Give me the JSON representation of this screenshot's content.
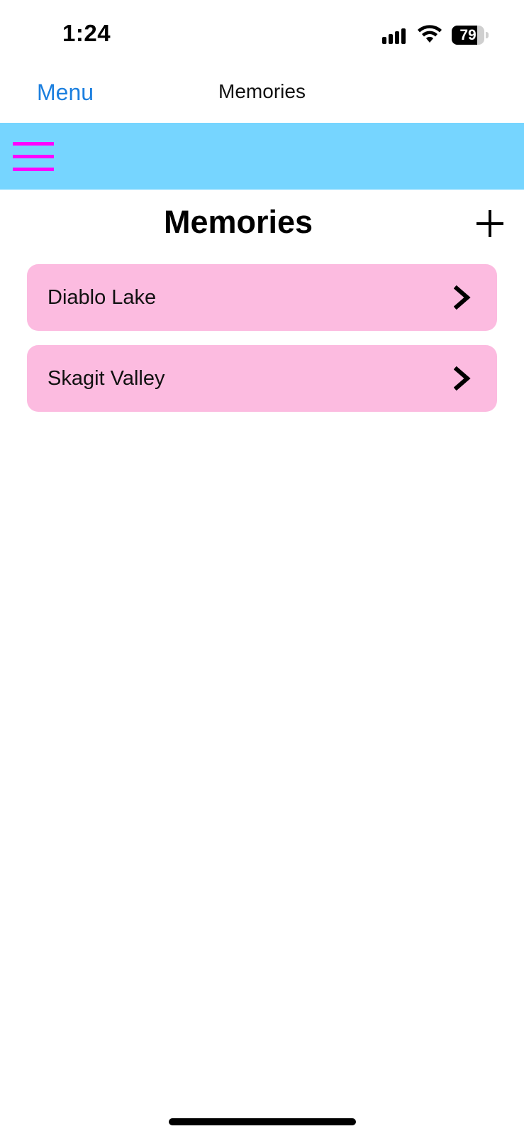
{
  "status_bar": {
    "time": "1:24",
    "battery_level": "79",
    "battery_fraction": 0.79,
    "signal_icon": "cellular-signal-icon",
    "wifi_icon": "wifi-icon"
  },
  "nav": {
    "back_label": "Menu",
    "title": "Memories"
  },
  "header": {
    "menu_icon": "hamburger-menu-icon",
    "add_icon": "plus-icon"
  },
  "page": {
    "title": "Memories"
  },
  "memories": [
    {
      "label": "Diablo Lake"
    },
    {
      "label": "Skagit Valley"
    }
  ],
  "colors": {
    "header_band": "#76d5ff",
    "hamburger": "#ff00ff",
    "row_background": "#fcbbe0",
    "link_blue": "#1b7fdf"
  }
}
